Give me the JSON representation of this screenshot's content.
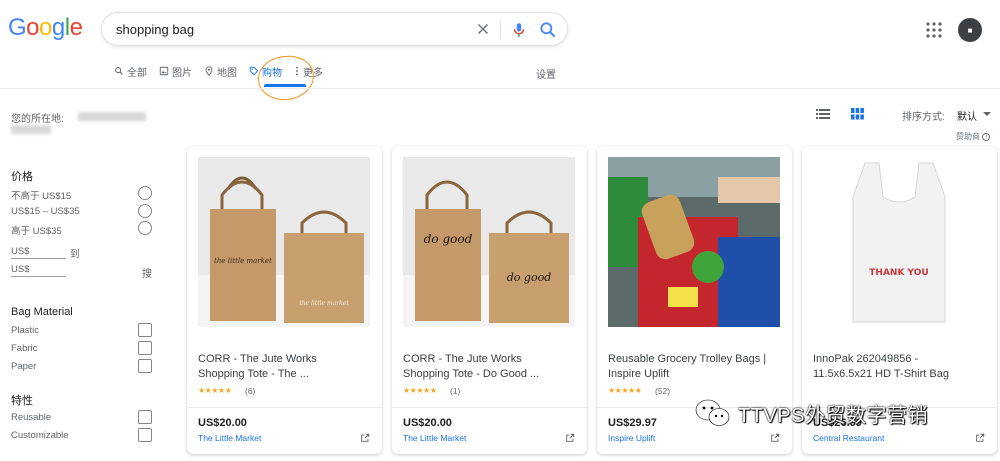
{
  "logo": "Google",
  "search": {
    "query": "shopping bag"
  },
  "tabs": [
    {
      "label": "全部",
      "icon": "search-icon"
    },
    {
      "label": "图片",
      "icon": "image-icon"
    },
    {
      "label": "地图",
      "icon": "map-pin-icon"
    },
    {
      "label": "购物",
      "icon": "tag-icon",
      "active": true
    },
    {
      "label": "更多",
      "icon": "more-vert-icon"
    }
  ],
  "settings": "设置",
  "location": {
    "label": "您的所在地:"
  },
  "sort": {
    "label": "排序方式:",
    "value": "默认"
  },
  "sponsored": "赞助商",
  "filters": {
    "price": {
      "heading": "价格",
      "options": [
        "不高于 US$15",
        "US$15 – US$35",
        "高于 US$35"
      ],
      "min_placeholder": "US$",
      "max_placeholder": "US$",
      "to": "到",
      "go": "搜"
    },
    "material": {
      "heading": "Bag Material",
      "options": [
        "Plastic",
        "Fabric",
        "Paper"
      ]
    },
    "features": {
      "heading": "特性",
      "options": [
        "Reusable",
        "Customizable"
      ]
    }
  },
  "products": [
    {
      "title_line1": "CORR - The Jute Works",
      "title_line2": "Shopping Tote - The ...",
      "stars": "★★★★★",
      "reviews": "(6)",
      "price": "US$20.00",
      "store": "The Little Market",
      "bag_text_big": "the little market",
      "bag_text_small": "the little market"
    },
    {
      "title_line1": "CORR - The Jute Works",
      "title_line2": "Shopping Tote - Do Good ...",
      "stars": "★★★★★",
      "reviews": "(1)",
      "price": "US$20.00",
      "store": "The Little Market",
      "bag_text_big": "do good",
      "bag_text_small": "do good"
    },
    {
      "title_line1": "Reusable Grocery Trolley Bags |",
      "title_line2": "Inspire Uplift",
      "stars": "★★★★★",
      "reviews": "(52)",
      "price": "US$29.97",
      "store": "Inspire Uplift"
    },
    {
      "title_line1": "InnoPak 262049856 -",
      "title_line2": "11.5x6.5x21 HD T-Shirt Bag",
      "stars": "",
      "reviews": "",
      "price": "US$26.99",
      "store": "Central Restaurant",
      "bag_text": "THANK YOU"
    }
  ],
  "watermark": "TTVPS外贸数字营销",
  "colors": {
    "accent": "#1a73e8",
    "highlight_circle": "#f29418",
    "star": "#f5a623"
  }
}
